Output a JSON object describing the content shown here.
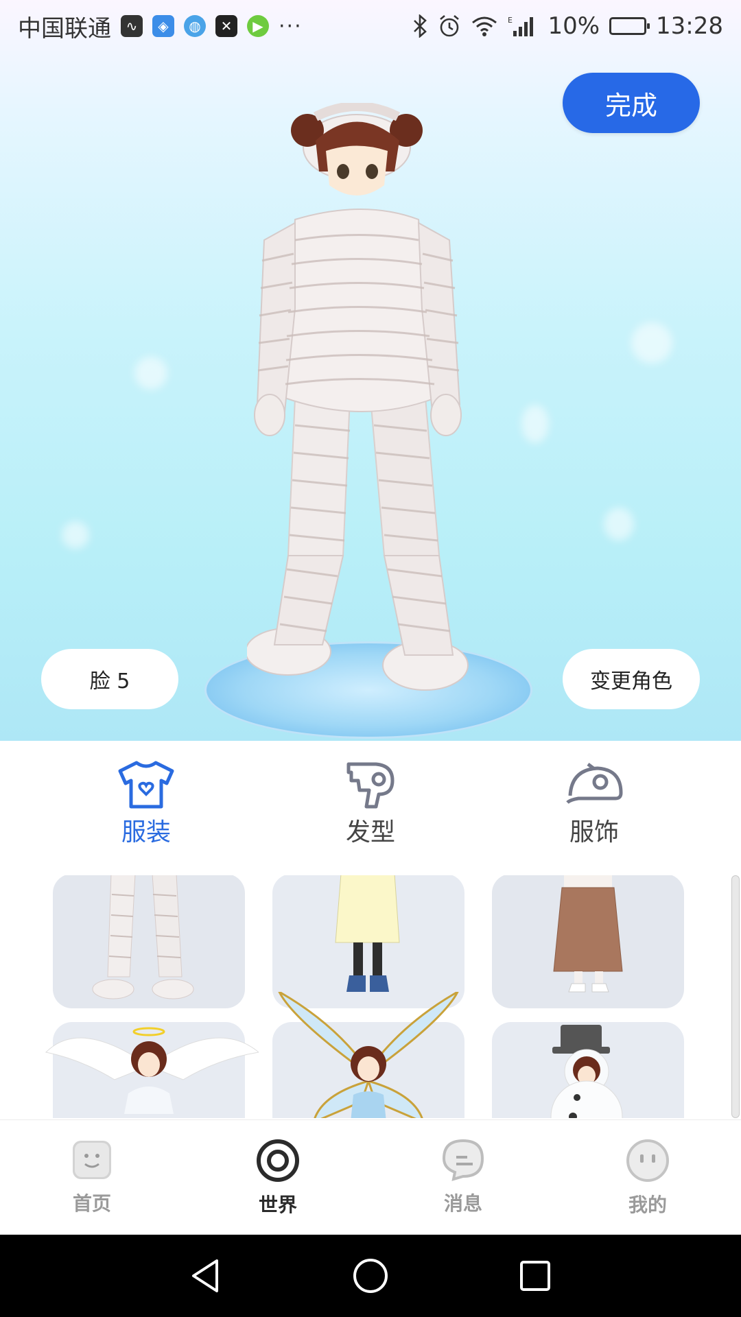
{
  "status_bar": {
    "carrier": "中国联通",
    "battery": "10%",
    "time": "13:28"
  },
  "header": {
    "done_label": "完成"
  },
  "scene": {
    "face_label": "脸 5",
    "change_role_label": "变更角色"
  },
  "categories": [
    {
      "label": "服装",
      "icon": "tshirt-icon",
      "active": true
    },
    {
      "label": "发型",
      "icon": "hair-dryer-icon",
      "active": false
    },
    {
      "label": "服饰",
      "icon": "cap-icon",
      "active": false
    }
  ],
  "bottom_nav": [
    {
      "label": "首页",
      "icon": "home-face-icon",
      "active": false
    },
    {
      "label": "世界",
      "icon": "world-ring-icon",
      "active": true
    },
    {
      "label": "消息",
      "icon": "message-bubble-icon",
      "active": false
    },
    {
      "label": "我的",
      "icon": "profile-face-icon",
      "active": false
    }
  ],
  "colors": {
    "accent": "#2769e7",
    "active_tab": "#2a6be0",
    "inactive": "#9a9a9a"
  }
}
